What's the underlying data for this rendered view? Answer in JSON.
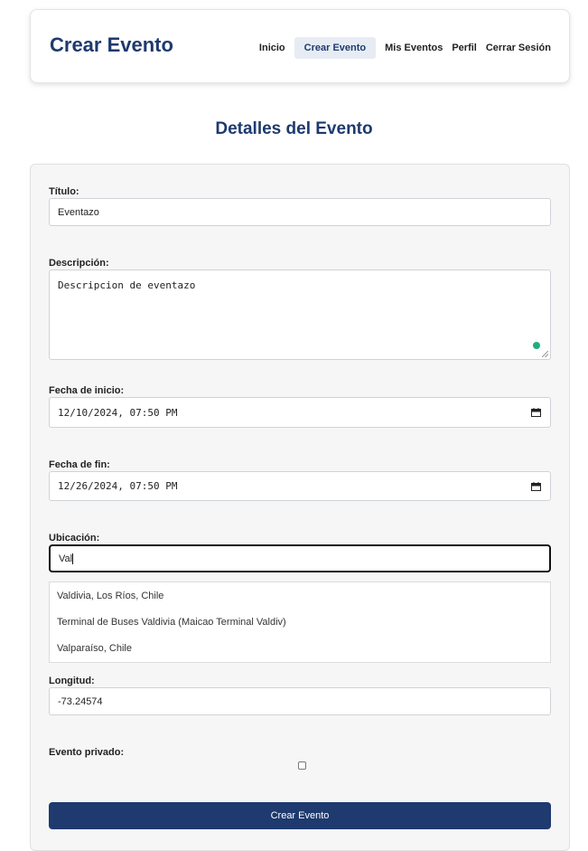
{
  "header": {
    "brand": "Crear Evento",
    "nav": {
      "inicio": "Inicio",
      "crear_evento": "Crear Evento",
      "mis_eventos": "Mis Eventos",
      "perfil": "Perfil",
      "cerrar_sesion": "Cerrar Sesión"
    }
  },
  "page": {
    "title": "Detalles del Evento"
  },
  "form": {
    "titulo": {
      "label": "Título:",
      "value": "Eventazo"
    },
    "descripcion": {
      "label": "Descripción:",
      "value": "Descripcion de eventazo"
    },
    "fecha_inicio": {
      "label": "Fecha de inicio:",
      "value": "12/10/2024, 07:50 PM"
    },
    "fecha_fin": {
      "label": "Fecha de fin:",
      "value": "12/26/2024, 07:50 PM"
    },
    "ubicacion": {
      "label": "Ubicación:",
      "value": "Val",
      "suggestions": [
        "Valdivia, Los Ríos, Chile",
        "Terminal de Buses Valdivia (Maicao Terminal Valdiv)",
        "Valparaíso, Chile"
      ]
    },
    "longitud": {
      "label": "Longitud:",
      "value": "-73.24574"
    },
    "privado": {
      "label": "Evento privado:",
      "checked": false
    },
    "submit": "Crear Evento"
  },
  "colors": {
    "brand": "#1e3a6e",
    "status_dot": "#1fae7c"
  }
}
